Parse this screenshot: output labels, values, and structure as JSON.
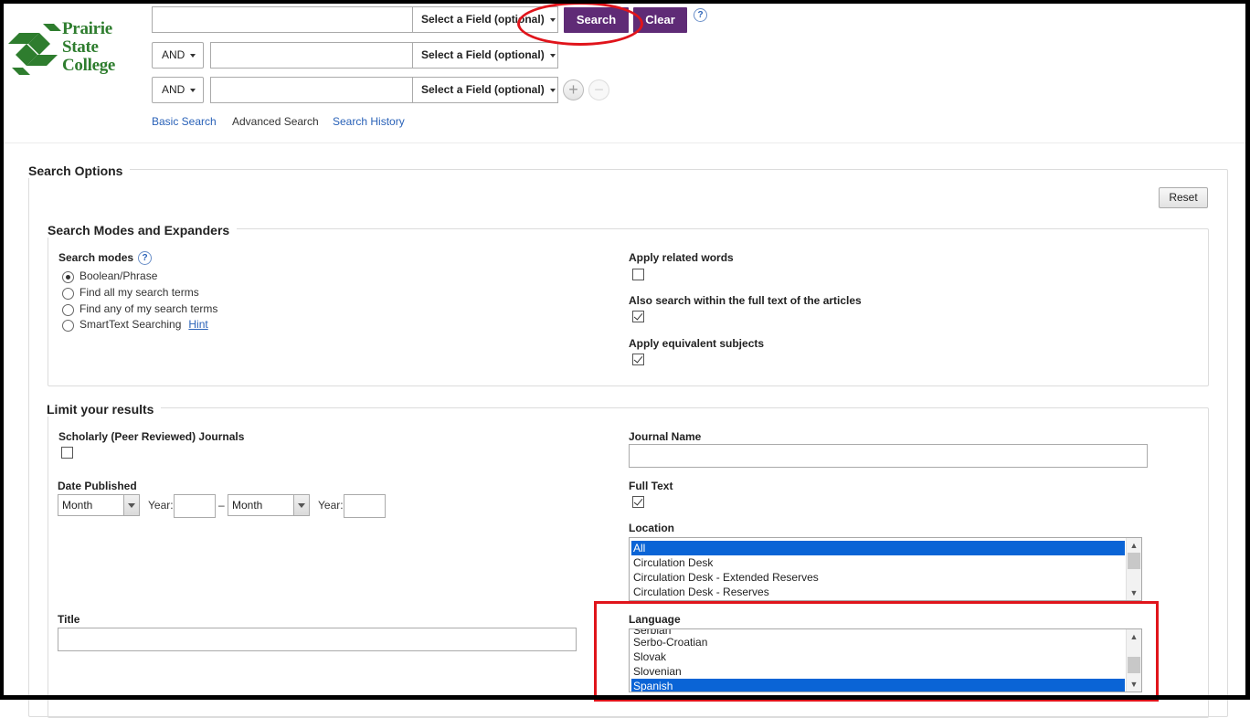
{
  "brand": {
    "name_lines": [
      "Prairie",
      "State",
      "College"
    ],
    "color": "#2e7d2e"
  },
  "search_rows": [
    {
      "query": "",
      "field_label": "Select a Field (optional)"
    },
    {
      "operator": "AND",
      "query": "",
      "field_label": "Select a Field (optional)"
    },
    {
      "operator": "AND",
      "query": "",
      "field_label": "Select a Field (optional)"
    }
  ],
  "buttons": {
    "search": "Search",
    "clear": "Clear",
    "help": "?",
    "add_row": "+",
    "remove_row": "−",
    "reset": "Reset"
  },
  "nav": {
    "basic": "Basic Search",
    "advanced": "Advanced Search",
    "history": "Search History"
  },
  "search_options": {
    "title": "Search Options",
    "modes_section": {
      "title": "Search Modes and Expanders",
      "modes_label": "Search modes",
      "modes": [
        {
          "label": "Boolean/Phrase",
          "selected": true
        },
        {
          "label": "Find all my search terms",
          "selected": false
        },
        {
          "label": "Find any of my search terms",
          "selected": false
        },
        {
          "label": "SmartText Searching",
          "selected": false
        }
      ],
      "hint": "Hint",
      "expanders": [
        {
          "label": "Apply related words",
          "checked": false
        },
        {
          "label": "Also search within the full text of the articles",
          "checked": true
        },
        {
          "label": "Apply equivalent subjects",
          "checked": true
        }
      ]
    },
    "limits": {
      "title": "Limit your results",
      "scholarly_label": "Scholarly (Peer Reviewed) Journals",
      "scholarly_checked": false,
      "journal_name_label": "Journal Name",
      "journal_name_value": "",
      "date_published_label": "Date Published",
      "month_placeholder": "Month",
      "year_label": "Year:",
      "date_separator": "–",
      "full_text_label": "Full Text",
      "full_text_checked": true,
      "location_label": "Location",
      "location_options": [
        "All",
        "Circulation Desk",
        "Circulation Desk - Extended Reserves",
        "Circulation Desk - Reserves"
      ],
      "location_selected": "All",
      "title_label": "Title",
      "title_value": "",
      "language_label": "Language",
      "language_options": [
        "Serbian",
        "Serbo-Croatian",
        "Slovak",
        "Slovenian",
        "Spanish"
      ],
      "language_selected": "Spanish"
    }
  },
  "colors": {
    "accent_purple": "#5f2b76",
    "link_blue": "#2a62b8",
    "annotation_red": "#e0141b",
    "selection_blue": "#0a64d6"
  }
}
